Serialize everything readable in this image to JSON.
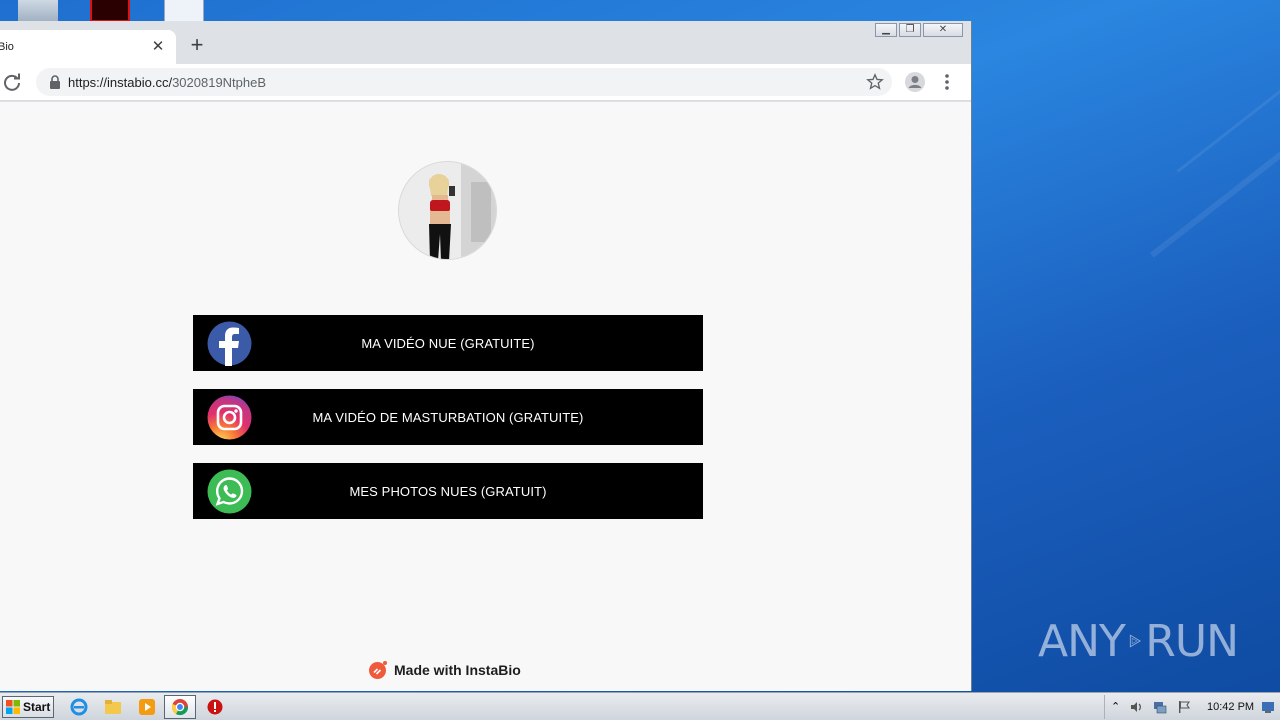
{
  "browser": {
    "tab_title": "Bio",
    "tab_close": "✕",
    "new_tab": "+",
    "url_host": "https://instabio.cc/",
    "url_path": "3020819NtpheB"
  },
  "profile": {
    "avatar_alt": "profile photo"
  },
  "links": [
    {
      "label": "MA VIDÉO NUE (GRATUITE)",
      "icon": "facebook-icon"
    },
    {
      "label": "MA VIDÉO DE MASTURBATION (GRATUITE)",
      "icon": "instagram-icon"
    },
    {
      "label": "MES PHOTOS NUES (GRATUIT)",
      "icon": "whatsapp-icon"
    }
  ],
  "footer": {
    "made_with": "Made with InstaBio"
  },
  "taskbar": {
    "start_label": "Start",
    "clock": "10:42 PM"
  },
  "watermark": {
    "left": "ANY",
    "right": "RUN"
  }
}
